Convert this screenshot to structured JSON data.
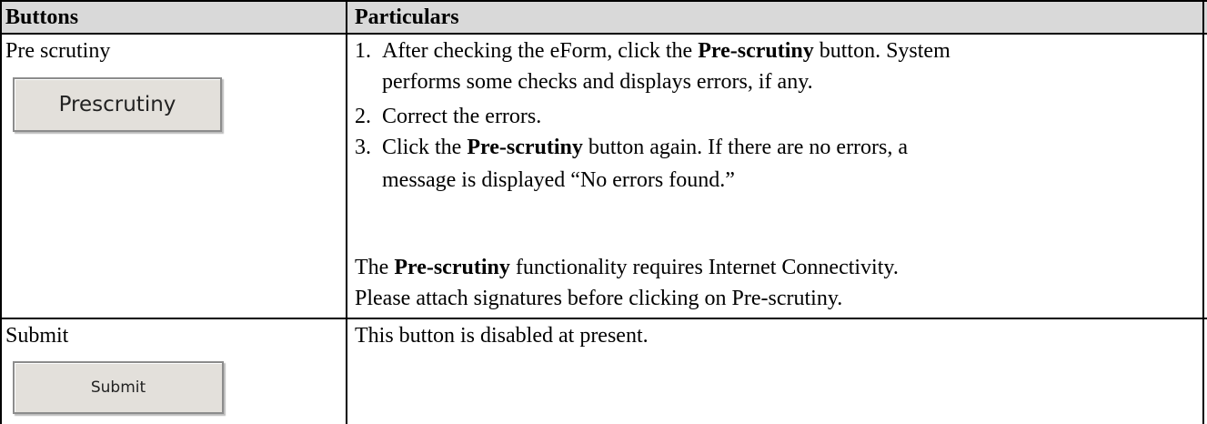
{
  "table": {
    "headers": {
      "buttons": "Buttons",
      "particulars": "Particulars"
    },
    "rows": [
      {
        "button_name": "Pre scrutiny",
        "button_label": "Prescrutiny",
        "steps": [
          {
            "num": "1.",
            "lines": [
              {
                "pre": "After checking the eForm, click the ",
                "bold": "Pre-scrutiny",
                "post": " button. System"
              },
              {
                "pre": "performs some checks and displays errors, if any.",
                "bold": "",
                "post": ""
              }
            ]
          },
          {
            "num": "2.",
            "lines": [
              {
                "pre": "Correct the errors.",
                "bold": "",
                "post": ""
              }
            ]
          },
          {
            "num": "3.",
            "lines": [
              {
                "pre": "Click the ",
                "bold": "Pre-scrutiny",
                "post": " button again. If there are no errors, a"
              },
              {
                "pre": "message is displayed “No errors found.”",
                "bold": "",
                "post": ""
              }
            ]
          }
        ],
        "note1": {
          "pre": "The ",
          "bold": "Pre-scrutiny",
          "post": " functionality requires Internet Connectivity."
        },
        "note2": "Please attach signatures before clicking on Pre-scrutiny."
      },
      {
        "button_name": "Submit",
        "button_label": "Submit",
        "particulars": "This button is disabled at present."
      }
    ]
  }
}
